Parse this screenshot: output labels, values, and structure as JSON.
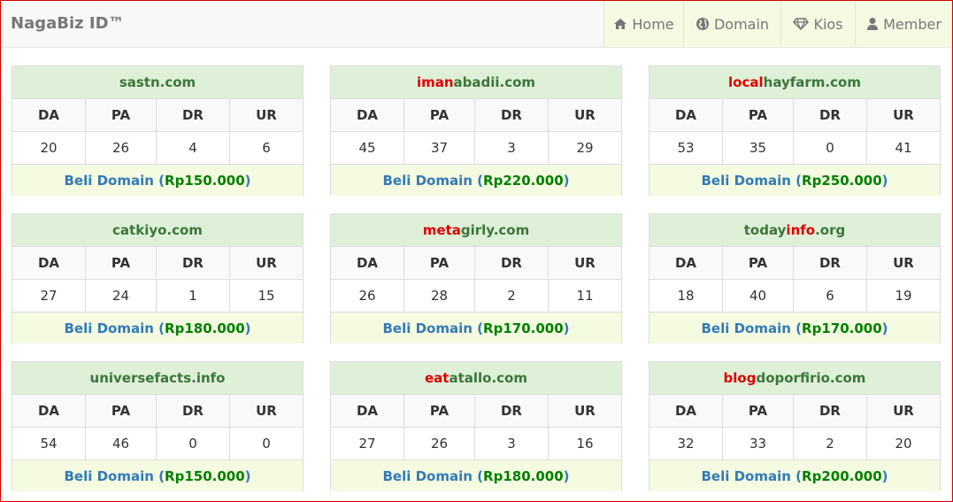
{
  "brand": "NagaBiz ID™",
  "nav": {
    "home": "Home",
    "domain": "Domain",
    "kios": "Kios",
    "member": "Member"
  },
  "colors": {
    "title_green": "#3c763d",
    "highlight_red": "#e00000",
    "link_blue": "#337ab7",
    "price_green": "#008000"
  },
  "headers": [
    "DA",
    "PA",
    "DR",
    "UR"
  ],
  "buy_label": "Beli Domain",
  "cards": [
    {
      "name_hl": "",
      "name_rest": "sastn.com",
      "da": "20",
      "pa": "26",
      "dr": "4",
      "ur": "6",
      "price": "Rp150.000"
    },
    {
      "name_hl": "iman",
      "name_rest": "abadii.com",
      "da": "45",
      "pa": "37",
      "dr": "3",
      "ur": "29",
      "price": "Rp220.000"
    },
    {
      "name_hl": "local",
      "name_rest": "hayfarm.com",
      "da": "53",
      "pa": "35",
      "dr": "0",
      "ur": "41",
      "price": "Rp250.000"
    },
    {
      "name_hl": "",
      "name_rest": "catkiyo.com",
      "da": "27",
      "pa": "24",
      "dr": "1",
      "ur": "15",
      "price": "Rp180.000"
    },
    {
      "name_hl": "meta",
      "name_rest": "girly.com",
      "da": "26",
      "pa": "28",
      "dr": "2",
      "ur": "11",
      "price": "Rp170.000"
    },
    {
      "name_pre": "today",
      "name_hl": "info",
      "name_rest": ".org",
      "da": "18",
      "pa": "40",
      "dr": "6",
      "ur": "19",
      "price": "Rp170.000"
    },
    {
      "name_hl": "",
      "name_rest": "universefacts.info",
      "da": "54",
      "pa": "46",
      "dr": "0",
      "ur": "0",
      "price": "Rp150.000"
    },
    {
      "name_hl": "eat",
      "name_rest": "atallo.com",
      "da": "27",
      "pa": "26",
      "dr": "3",
      "ur": "16",
      "price": "Rp180.000"
    },
    {
      "name_hl": "blog",
      "name_rest": "doporfirio.com",
      "da": "32",
      "pa": "33",
      "dr": "2",
      "ur": "20",
      "price": "Rp200.000"
    }
  ]
}
